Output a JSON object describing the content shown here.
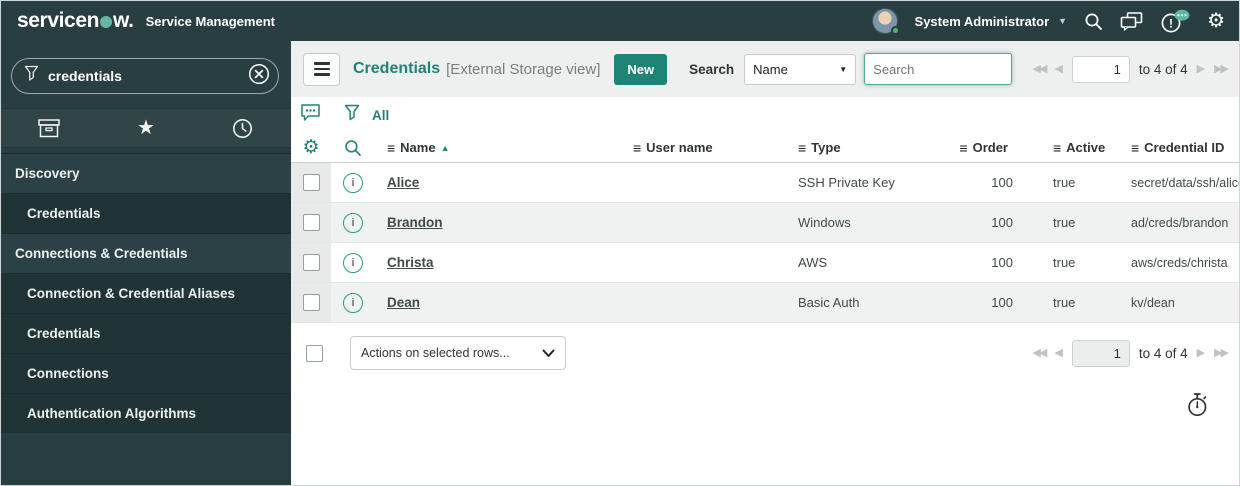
{
  "colors": {
    "accent": "#1f8476",
    "header_bg": "#293e40",
    "logo_dot": "#63b8a5",
    "row_alt_bg": "#f0f2f2",
    "checkbox_col_bg": "#e8eaea"
  },
  "top_nav": {
    "logo_pre": "servicen",
    "logo_post": "w.",
    "product_name": "Service Management",
    "user_name": "System Administrator"
  },
  "sidebar": {
    "filter_value": "credentials",
    "items": [
      {
        "label": "Discovery",
        "type": "section"
      },
      {
        "label": "Credentials",
        "type": "item"
      },
      {
        "label": "Connections & Credentials",
        "type": "section"
      },
      {
        "label": "Connection & Credential Aliases",
        "type": "item"
      },
      {
        "label": "Credentials",
        "type": "item"
      },
      {
        "label": "Connections",
        "type": "item"
      },
      {
        "label": "Authentication Algorithms",
        "type": "item"
      }
    ]
  },
  "list_header": {
    "title": "Credentials",
    "view_label": "[External Storage view]",
    "new_button_label": "New",
    "search_label": "Search",
    "search_column_selected": "Name",
    "search_placeholder": "Search"
  },
  "breadcrumb": {
    "all_label": "All"
  },
  "pagination_top": {
    "page": "1",
    "range": "to 4 of 4"
  },
  "pagination_bottom": {
    "page": "1",
    "range": "to 4 of 4"
  },
  "table": {
    "columns": [
      {
        "label": "Name",
        "sort_glyph": "▲"
      },
      {
        "label": "User name"
      },
      {
        "label": "Type"
      },
      {
        "label": "Order",
        "align": "right"
      },
      {
        "label": "Active"
      },
      {
        "label": "Credential ID"
      }
    ],
    "rows": [
      {
        "name": "Alice",
        "user_name": "",
        "type": "SSH Private Key",
        "order": "100",
        "active": "true",
        "credential_id": "secret/data/ssh/alice"
      },
      {
        "name": "Brandon",
        "user_name": "",
        "type": "Windows",
        "order": "100",
        "active": "true",
        "credential_id": "ad/creds/brandon"
      },
      {
        "name": "Christa",
        "user_name": "",
        "type": "AWS",
        "order": "100",
        "active": "true",
        "credential_id": "aws/creds/christa"
      },
      {
        "name": "Dean",
        "user_name": "",
        "type": "Basic Auth",
        "order": "100",
        "active": "true",
        "credential_id": "kv/dean"
      }
    ]
  },
  "footer": {
    "actions_placeholder": "Actions on selected rows..."
  }
}
